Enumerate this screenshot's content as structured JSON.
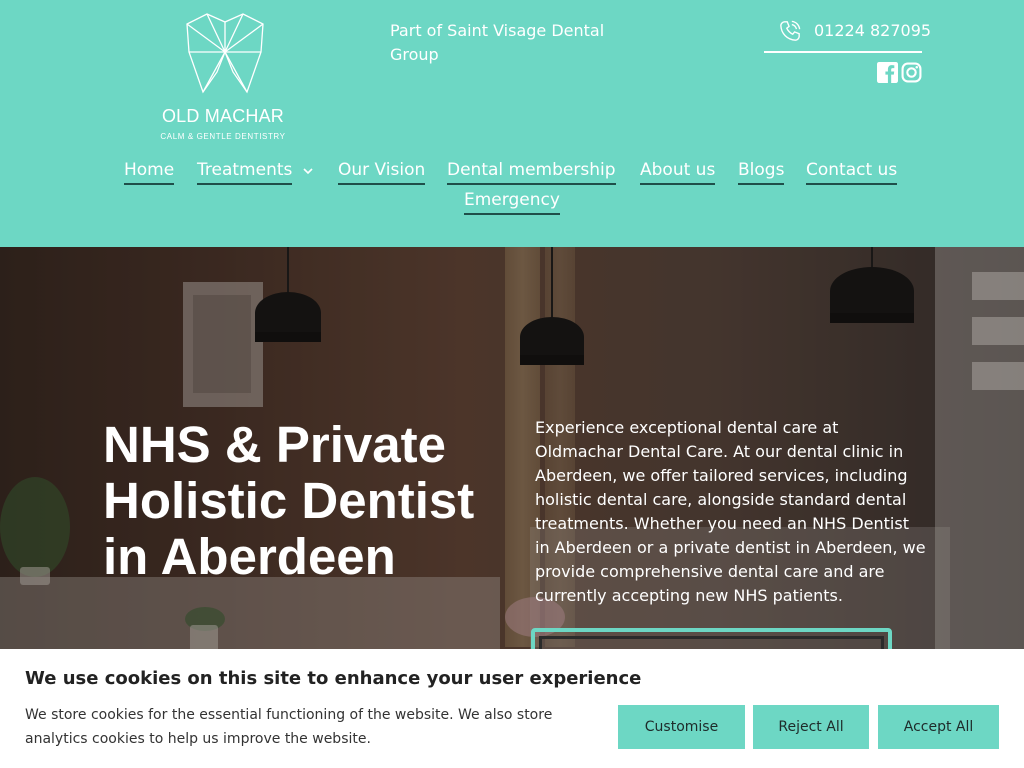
{
  "header": {
    "logo_name": "OLD MACHAR",
    "logo_tagline": "CALM & GENTLE DENTISTRY",
    "group_text": "Part of Saint Visage Dental Group",
    "phone": "01224 827095",
    "accent_color": "#6dd7c4",
    "icons": [
      "phone-icon",
      "facebook-icon",
      "instagram-icon"
    ]
  },
  "nav": {
    "home": "Home",
    "treatments": "Treatments",
    "our_vision": "Our Vision",
    "dental_membership": "Dental membership",
    "about_us": "About us",
    "blogs": "Blogs",
    "contact_us": "Contact us",
    "emergency": "Emergency"
  },
  "hero": {
    "title": "NHS & Private Holistic Dentist in Aberdeen",
    "description": "Experience exceptional dental care at Oldmachar Dental Care. At our dental clinic in Aberdeen, we offer tailored services, including holistic dental care, alongside standard dental treatments. Whether you need an NHS Dentist in Aberdeen or a private dentist in Aberdeen, we provide comprehensive dental care and are currently accepting new NHS patients."
  },
  "cookie": {
    "title": "We use cookies on this site to enhance your user experience",
    "text": "We store cookies for the essential functioning of the website. We also store analytics cookies to help us improve the website.",
    "customise": "Customise",
    "reject_all": "Reject All",
    "accept_all": "Accept All"
  }
}
